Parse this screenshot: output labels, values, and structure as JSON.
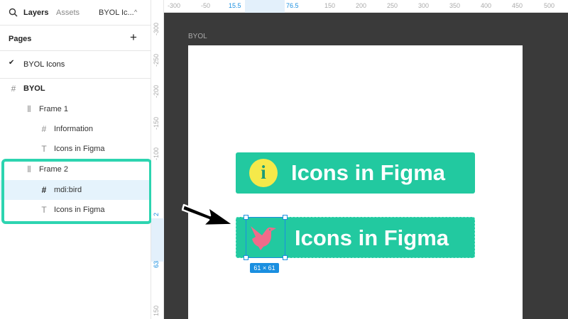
{
  "left_panel": {
    "tabs": {
      "layers": "Layers",
      "assets": "Assets",
      "page_selector": "BYOL Ic...",
      "chevron": "^"
    },
    "pages": {
      "title": "Pages",
      "add": "+",
      "items": [
        {
          "label": "BYOL Icons",
          "checked": true
        }
      ]
    },
    "layers": [
      {
        "label": "BYOL",
        "type": "frame"
      },
      {
        "label": "Frame 1",
        "type": "auto-layout"
      },
      {
        "label": "Information",
        "type": "frame"
      },
      {
        "label": "Icons in Figma",
        "type": "text"
      },
      {
        "label": "Frame 2",
        "type": "auto-layout"
      },
      {
        "label": "mdi:bird",
        "type": "frame",
        "selected": true
      },
      {
        "label": "Icons in Figma",
        "type": "text"
      }
    ]
  },
  "ruler_top": [
    "-300",
    "-50",
    "15.5",
    "76.5",
    "150",
    "200",
    "250",
    "300",
    "350",
    "400",
    "450",
    "500"
  ],
  "ruler_left": [
    "-300",
    "-250",
    "-200",
    "-150",
    "-100",
    "2",
    "63",
    "150"
  ],
  "canvas": {
    "frame_label": "BYOL",
    "banner1_text": "Icons in Figma",
    "info_glyph": "i",
    "banner2_text": "Icons in Figma",
    "selection_size": "61 × 61"
  },
  "colors": {
    "accent": "#22c9a0",
    "highlight": "#2dd4b0",
    "selection": "#1a8fe0",
    "bird": "#f06b8a",
    "info": "#f5e94a"
  },
  "icons": {
    "search": "search-icon",
    "check": "check-icon",
    "frame": "hash-icon",
    "auto_layout": "auto-layout-icon",
    "text": "text-icon",
    "bird": "bird-icon",
    "info": "info-icon",
    "arrow": "arrow-icon"
  }
}
